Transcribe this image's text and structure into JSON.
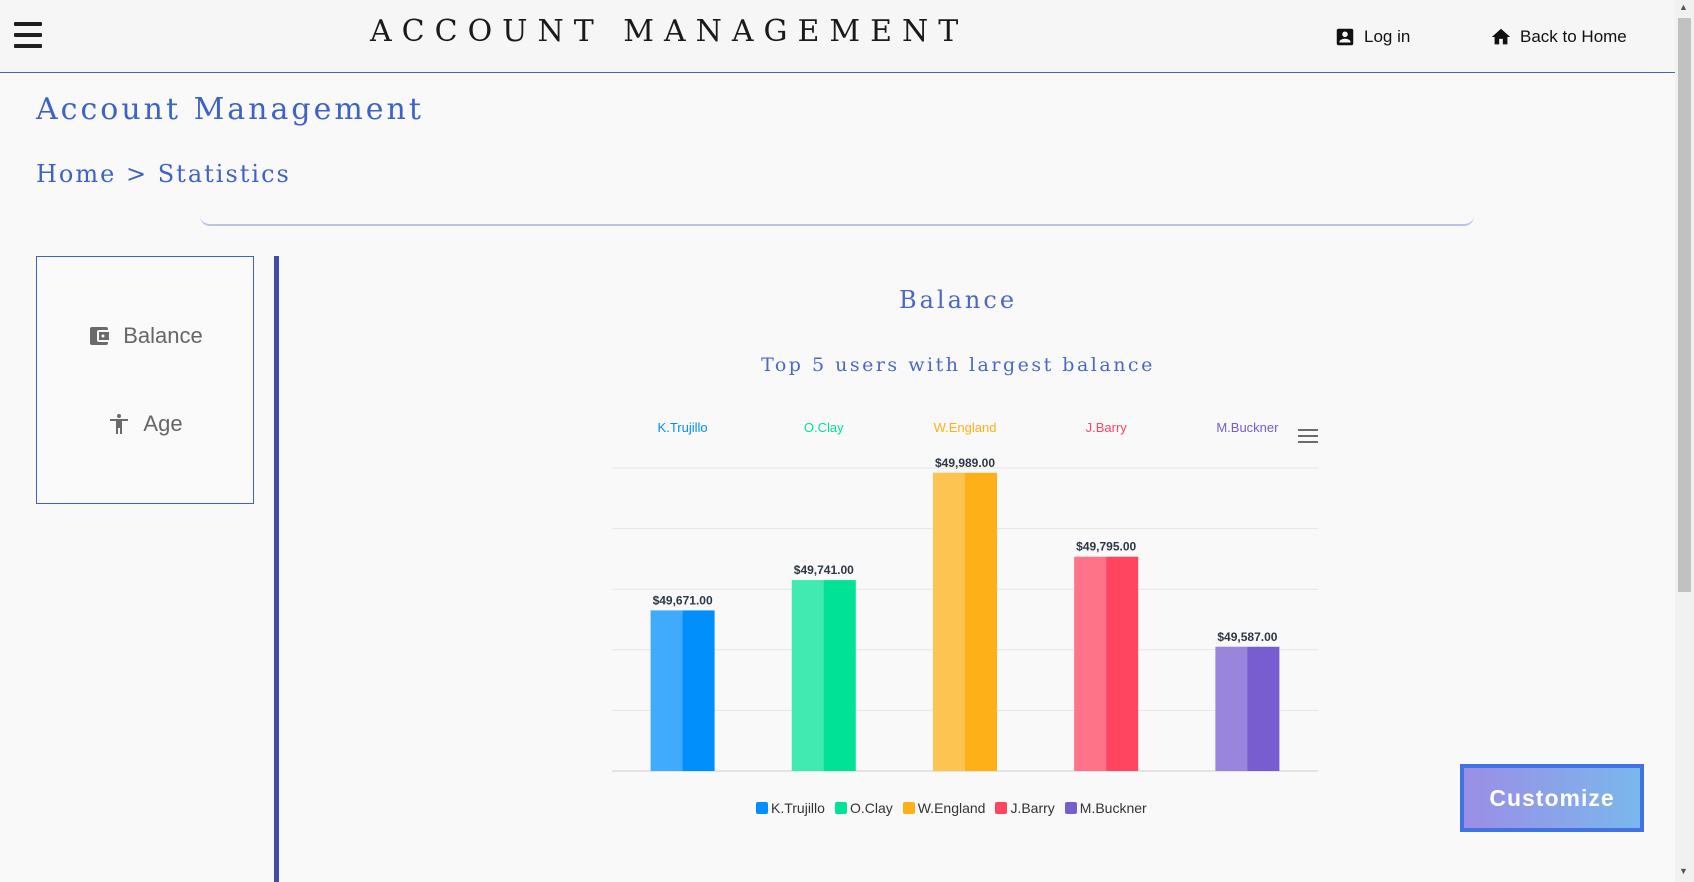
{
  "header": {
    "brand": "ACCOUNT MANAGEMENT",
    "login_label": "Log in",
    "home_label": "Back to Home"
  },
  "page": {
    "title": "Account Management",
    "breadcrumb_home": "Home",
    "breadcrumb_sep": ">",
    "breadcrumb_current": "Statistics"
  },
  "sidebar": {
    "items": [
      {
        "label": "Balance",
        "icon": "wallet-icon"
      },
      {
        "label": "Age",
        "icon": "accessibility-icon"
      }
    ]
  },
  "chart_data": {
    "type": "bar",
    "title": "Balance",
    "subtitle": "Top 5 users with largest balance",
    "categories": [
      "K.Trujillo",
      "O.Clay",
      "W.England",
      "J.Barry",
      "M.Buckner"
    ],
    "values": [
      49671,
      49741,
      49989,
      49795,
      49587
    ],
    "value_labels": [
      "$49,671.00",
      "$49,741.00",
      "$49,989.00",
      "$49,795.00",
      "$49,587.00"
    ],
    "colors": [
      "#008ffb",
      "#00e396",
      "#feb019",
      "#ff4560",
      "#775dd0"
    ],
    "ylim": [
      49300,
      50000
    ],
    "grid": true,
    "legend_position": "bottom",
    "xlabel": "",
    "ylabel": ""
  },
  "customize_label": "Customize"
}
